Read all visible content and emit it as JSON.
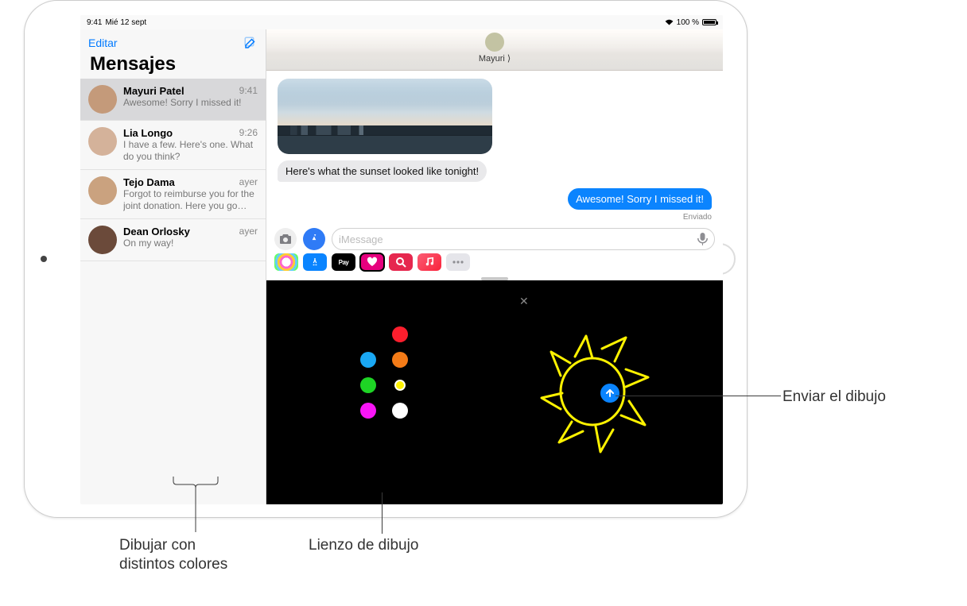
{
  "statusbar": {
    "time": "9:41",
    "date": "Mié 12 sept",
    "battery": "100 %"
  },
  "sidebar": {
    "edit_label": "Editar",
    "title": "Mensajes",
    "conversations": [
      {
        "name": "Mayuri Patel",
        "time": "9:41",
        "preview": "Awesome! Sorry I missed it!",
        "selected": true,
        "av": "#c49a7a"
      },
      {
        "name": "Lia Longo",
        "time": "9:26",
        "preview": "I have a few. Here's one. What do you think?",
        "selected": false,
        "av": "#d4b29a"
      },
      {
        "name": "Tejo Dama",
        "time": "ayer",
        "preview": "Forgot to reimburse you for the joint donation. Here you go…",
        "selected": false,
        "av": "#caa27f"
      },
      {
        "name": "Dean Orlosky",
        "time": "ayer",
        "preview": "On my way!",
        "selected": false,
        "av": "#6b4a3a"
      }
    ]
  },
  "chat": {
    "contact": "Mayuri ⟩",
    "messages": {
      "left_text": "Here's what the sunset looked like tonight!",
      "right_text": "Awesome! Sorry I missed it!",
      "right_status": "Enviado"
    },
    "compose": {
      "placeholder": "iMessage"
    },
    "apps": {
      "pay": "Pay"
    }
  },
  "digital_touch": {
    "colors": [
      "cyan",
      "red",
      "orange",
      "green",
      "yellow",
      "magenta",
      "white"
    ]
  },
  "callouts": {
    "send": "Enviar el dibujo",
    "canvas": "Lienzo de dibujo",
    "palette": "Dibujar con\ndistintos colores"
  }
}
